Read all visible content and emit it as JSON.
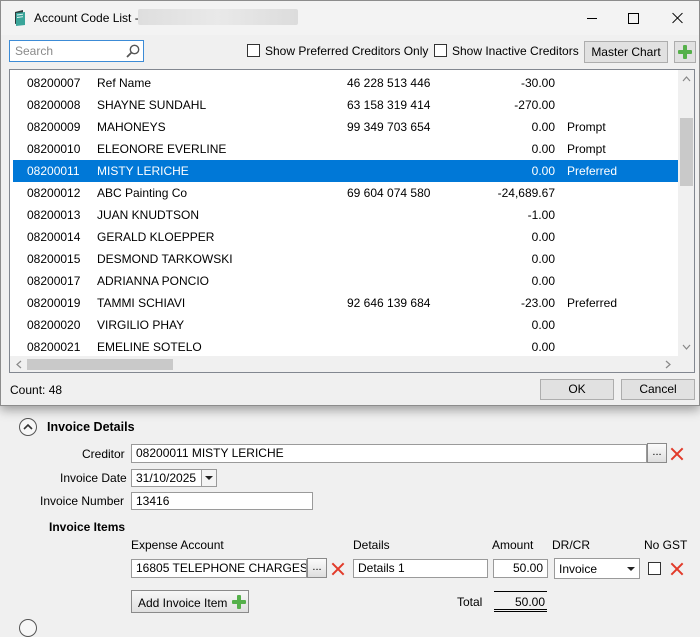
{
  "dialog": {
    "title": "Account Code List -",
    "search_placeholder": "Search",
    "show_preferred_label": "Show Preferred Creditors Only",
    "show_inactive_label": "Show Inactive Creditors",
    "master_chart_label": "Master Chart",
    "count_label": "Count: 48",
    "ok_label": "OK",
    "cancel_label": "Cancel",
    "selected_index": 4,
    "rows": [
      {
        "code": "08200007",
        "name": "Ref Name",
        "abn": "46 228 513 446",
        "balance": "-30.00",
        "flag": ""
      },
      {
        "code": "08200008",
        "name": "SHAYNE SUNDAHL",
        "abn": "63 158 319 414",
        "balance": "-270.00",
        "flag": ""
      },
      {
        "code": "08200009",
        "name": "MAHONEYS",
        "abn": "99 349 703 654",
        "balance": "0.00",
        "flag": "Prompt"
      },
      {
        "code": "08200010",
        "name": "ELEONORE EVERLINE",
        "abn": "",
        "balance": "0.00",
        "flag": "Prompt"
      },
      {
        "code": "08200011",
        "name": "MISTY LERICHE",
        "abn": "",
        "balance": "0.00",
        "flag": "Preferred"
      },
      {
        "code": "08200012",
        "name": "ABC Painting Co",
        "abn": "69 604 074 580",
        "balance": "-24,689.67",
        "flag": ""
      },
      {
        "code": "08200013",
        "name": "JUAN KNUDTSON",
        "abn": "",
        "balance": "-1.00",
        "flag": ""
      },
      {
        "code": "08200014",
        "name": "GERALD KLOEPPER",
        "abn": "",
        "balance": "0.00",
        "flag": ""
      },
      {
        "code": "08200015",
        "name": "DESMOND TARKOWSKI",
        "abn": "",
        "balance": "0.00",
        "flag": ""
      },
      {
        "code": "08200017",
        "name": "ADRIANNA PONCIO",
        "abn": "",
        "balance": "0.00",
        "flag": ""
      },
      {
        "code": "08200019",
        "name": "TAMMI SCHIAVI",
        "abn": "92 646 139 684",
        "balance": "-23.00",
        "flag": "Preferred"
      },
      {
        "code": "08200020",
        "name": "VIRGILIO PHAY",
        "abn": "",
        "balance": "0.00",
        "flag": ""
      },
      {
        "code": "08200021",
        "name": "EMELINE SOTELO",
        "abn": "",
        "balance": "0.00",
        "flag": ""
      }
    ]
  },
  "form": {
    "section_title": "Invoice Details",
    "creditor_label": "Creditor",
    "creditor_value": "08200011 MISTY LERICHE",
    "invoice_date_label": "Invoice Date",
    "invoice_date_value": "31/10/2025",
    "invoice_number_label": "Invoice Number",
    "invoice_number_value": "13416",
    "items_title": "Invoice Items",
    "col_expense": "Expense Account",
    "col_details": "Details",
    "col_amount": "Amount",
    "col_drcr": "DR/CR",
    "col_nogst": "No GST",
    "item_expense": "16805 TELEPHONE CHARGES",
    "item_details": "Details 1",
    "item_amount": "50.00",
    "item_drcr": "Invoice",
    "add_item_label": "Add Invoice Item",
    "total_label": "Total",
    "total_value": "50.00",
    "ellipsis": "..."
  },
  "icons": {
    "app": "ledger-book-icon",
    "search": "search-icon",
    "add": "plus-icon",
    "delete": "red-x-icon",
    "collapse": "chevron-up-icon"
  },
  "colors": {
    "selection": "#0078d7",
    "add_green": "#55b04a",
    "delete_red": "#e23a2a"
  }
}
